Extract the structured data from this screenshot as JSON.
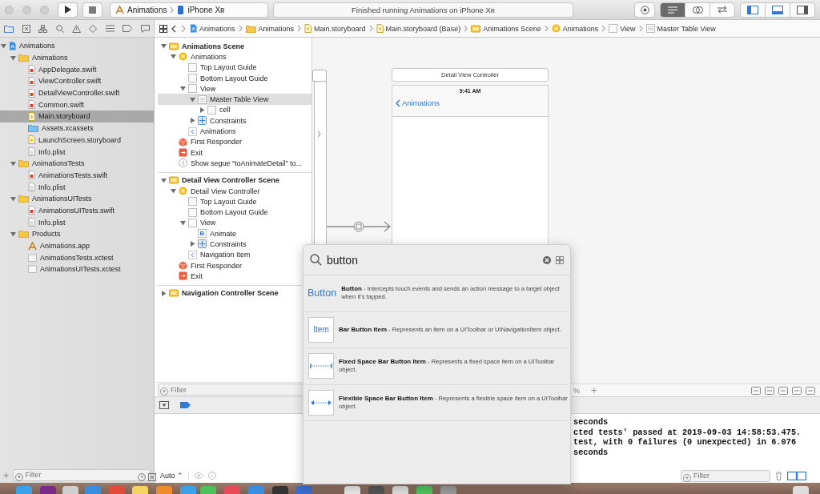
{
  "toolbar": {
    "scheme": [
      "Animations",
      "iPhone Xʀ"
    ],
    "status": "Finished running Animations on iPhone Xʀ"
  },
  "jump_bar": [
    {
      "label": "Animations",
      "kind": "project"
    },
    {
      "label": "Animations",
      "kind": "folder"
    },
    {
      "label": "Main.storyboard",
      "kind": "storyboard"
    },
    {
      "label": "Main.storyboard (Base)",
      "kind": "storyboard"
    },
    {
      "label": "Animations Scene",
      "kind": "scene"
    },
    {
      "label": "Animations",
      "kind": "controller"
    },
    {
      "label": "View",
      "kind": "view"
    },
    {
      "label": "Master Table View",
      "kind": "table"
    }
  ],
  "navigator": {
    "items": [
      {
        "label": "Animations",
        "kind": "project",
        "selected": false,
        "expanded": true,
        "children": [
          {
            "label": "Animations",
            "kind": "folder",
            "selected": false,
            "expanded": true,
            "children": [
              {
                "label": "AppDelegate.swift",
                "kind": "swift",
                "selected": false
              },
              {
                "label": "ViewController.swift",
                "kind": "swift",
                "selected": false
              },
              {
                "label": "DetailViewController.swift",
                "kind": "swift",
                "selected": false
              },
              {
                "label": "Common.swift",
                "kind": "swift",
                "selected": false
              },
              {
                "label": "Main.storyboard",
                "kind": "storyboard",
                "selected": true
              },
              {
                "label": "Assets.xcassets",
                "kind": "assets",
                "selected": false
              },
              {
                "label": "LaunchScreen.storyboard",
                "kind": "storyboard",
                "selected": false
              },
              {
                "label": "Info.plist",
                "kind": "plist",
                "selected": false
              }
            ]
          },
          {
            "label": "AnimationsTests",
            "kind": "folder",
            "selected": false,
            "expanded": true,
            "children": [
              {
                "label": "AnimationsTests.swift",
                "kind": "swift",
                "selected": false
              },
              {
                "label": "Info.plist",
                "kind": "plist",
                "selected": false
              }
            ]
          },
          {
            "label": "AnimationsUITests",
            "kind": "folder",
            "selected": false,
            "expanded": true,
            "children": [
              {
                "label": "AnimationsUITests.swift",
                "kind": "swift",
                "selected": false
              },
              {
                "label": "Info.plist",
                "kind": "plist",
                "selected": false
              }
            ]
          },
          {
            "label": "Products",
            "kind": "folder",
            "selected": false,
            "expanded": true,
            "children": [
              {
                "label": "Animations.app",
                "kind": "app",
                "selected": false
              },
              {
                "label": "AnimationsTests.xctest",
                "kind": "xctest",
                "selected": false
              },
              {
                "label": "AnimationsUITests.xctest",
                "kind": "xctest",
                "selected": false
              }
            ]
          }
        ]
      }
    ],
    "filter_placeholder": "Filter",
    "add": "+"
  },
  "outline": {
    "items": [
      {
        "label": "Animations Scene",
        "kind": "scene",
        "selected": false,
        "expanded": true,
        "children": [
          {
            "label": "Animations",
            "kind": "controller",
            "selected": false,
            "expanded": true,
            "children": [
              {
                "label": "Top Layout Guide",
                "kind": "guide",
                "selected": false
              },
              {
                "label": "Bottom Layout Guide",
                "kind": "guide",
                "selected": false
              },
              {
                "label": "View",
                "kind": "view",
                "selected": false,
                "expanded": true,
                "children": [
                  {
                    "label": "Master Table View",
                    "kind": "table",
                    "selected": true,
                    "expanded": true,
                    "children": [
                      {
                        "label": "cell",
                        "kind": "cell",
                        "selected": false,
                        "expanded": false
                      }
                    ]
                  },
                  {
                    "label": "Constraints",
                    "kind": "constraints",
                    "selected": false,
                    "expanded": false
                  }
                ]
              },
              {
                "label": "Animations",
                "kind": "navitem",
                "selected": false
              }
            ]
          },
          {
            "label": "First Responder",
            "kind": "responder",
            "selected": false
          },
          {
            "label": "Exit",
            "kind": "exit",
            "selected": false
          },
          {
            "label": "Show segue “toAnimateDetail” to...",
            "kind": "segue",
            "selected": false
          }
        ]
      },
      {
        "label": "Detail View Controller Scene",
        "kind": "scene",
        "selected": false,
        "expanded": true,
        "children": [
          {
            "label": "Detail View Controller",
            "kind": "controller",
            "selected": false,
            "expanded": true,
            "children": [
              {
                "label": "Top Layout Guide",
                "kind": "guide",
                "selected": false
              },
              {
                "label": "Bottom Layout Guide",
                "kind": "guide",
                "selected": false
              },
              {
                "label": "View",
                "kind": "view",
                "selected": false,
                "expanded": true,
                "children": [
                  {
                    "label": "Animate",
                    "kind": "button",
                    "badge": "B",
                    "selected": false
                  },
                  {
                    "label": "Constraints",
                    "kind": "constraints",
                    "selected": false,
                    "expanded": false
                  }
                ]
              },
              {
                "label": "Navigation Item",
                "kind": "navitem",
                "selected": false
              }
            ]
          },
          {
            "label": "First Responder",
            "kind": "responder",
            "selected": false
          },
          {
            "label": "Exit",
            "kind": "exit",
            "selected": false
          }
        ]
      },
      {
        "label": "Navigation Controller Scene",
        "kind": "scene",
        "selected": false,
        "expanded": false
      }
    ],
    "filter_placeholder": "Filter"
  },
  "canvas": {
    "detail_title": "Detail View Controller",
    "time": "9:41 AM",
    "back": "Animations",
    "zoom": "%",
    "add": "+"
  },
  "debug": {
    "mode": "Auto ⌃",
    "console_lines": [
      "seconds",
      "cted tests' passed at 2019-09-03 14:58:53.475.",
      "test, with 0 failures (0 unexpected) in 6.076",
      "seconds"
    ],
    "filter_placeholder": "Filter"
  },
  "library": {
    "query": "button",
    "items": [
      {
        "kind": "button",
        "preview": "Button",
        "text": "**Button** - Intercepts touch events and sends an action message to a target object when it's tapped."
      },
      {
        "kind": "bar_item",
        "preview": "Item",
        "text": "**Bar Button Item** - Represents an item on a UIToolbar or UINavigationItem object."
      },
      {
        "kind": "fixed_space",
        "text": "**Fixed Space Bar Button Item** - Represents a fixed space item on a UIToolbar object."
      },
      {
        "kind": "flexible_space",
        "text": "**Flexible Space Bar Button Item** - Represents a flexible space item on a UIToolbar object."
      }
    ]
  }
}
